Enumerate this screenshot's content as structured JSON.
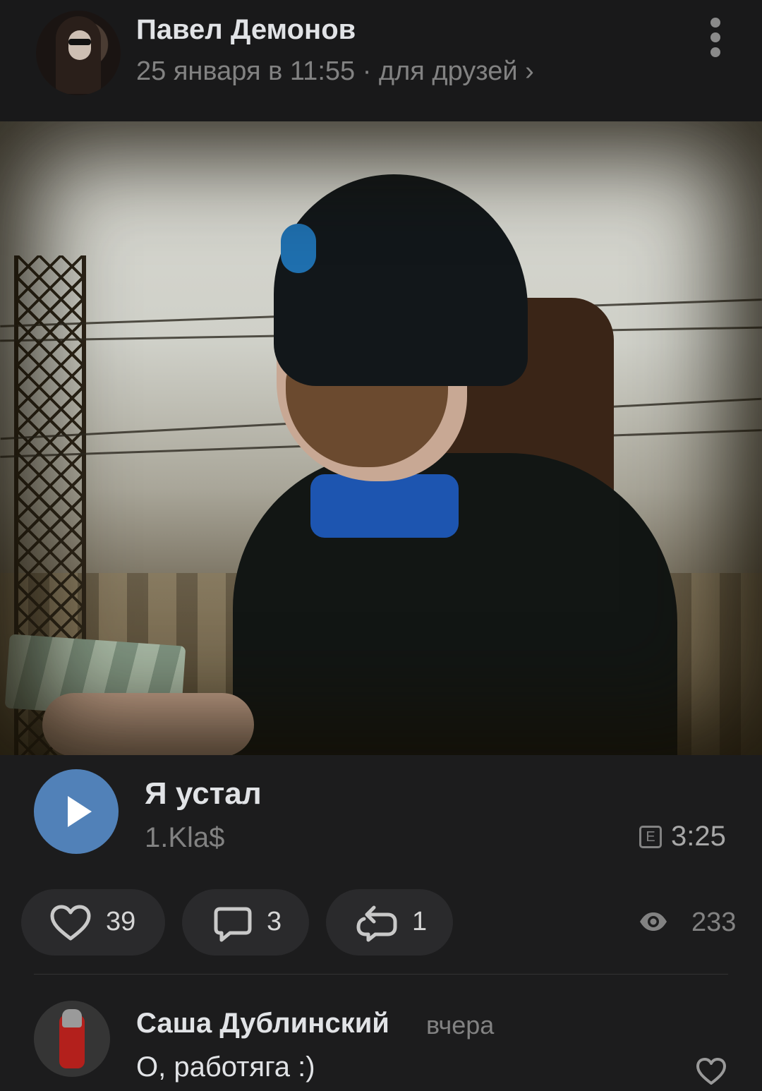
{
  "post": {
    "author": "Павел Демонов",
    "meta": "25 января в 11:55 · для друзей ›"
  },
  "audio": {
    "title": "Я устал",
    "artist": "1.Kla$",
    "explicit_badge": "E",
    "duration": "3:25"
  },
  "actions": {
    "likes": "39",
    "comments": "3",
    "reposts": "1",
    "views": "233"
  },
  "comment": {
    "author": "Саша Дублинский",
    "time": "вчера",
    "text": "О, работяга :)"
  },
  "colors": {
    "background": "#1c1c1d",
    "accent": "#5181b8",
    "secondary_text": "#828282"
  },
  "icons": [
    "more-vertical-icon",
    "play-icon",
    "explicit-icon",
    "heart-icon",
    "comment-icon",
    "repost-icon",
    "eye-icon"
  ]
}
